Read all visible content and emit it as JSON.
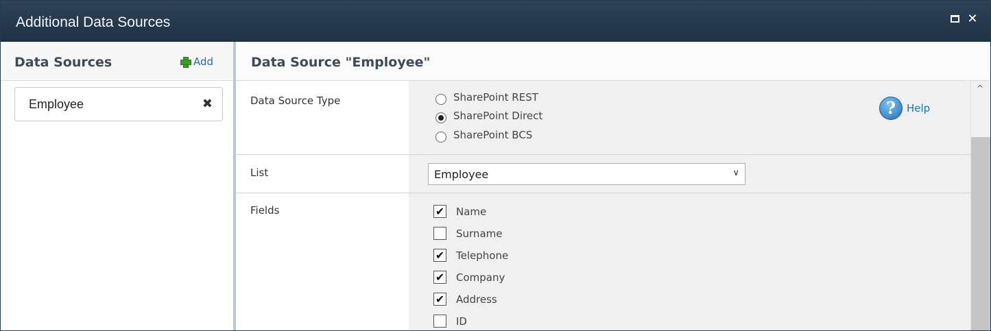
{
  "window": {
    "title": "Additional Data Sources"
  },
  "left": {
    "header": "Data Sources",
    "add_label": "Add",
    "items": [
      {
        "label": "Employee"
      }
    ]
  },
  "right": {
    "header": "Data Source \"Employee\"",
    "type_label": "Data Source Type",
    "type_options": [
      {
        "label": "SharePoint REST",
        "selected": false
      },
      {
        "label": "SharePoint Direct",
        "selected": true
      },
      {
        "label": "SharePoint BCS",
        "selected": false
      }
    ],
    "help_label": "Help",
    "list_label": "List",
    "list_value": "Employee",
    "fields_label": "Fields",
    "fields": [
      {
        "label": "Name",
        "checked": true
      },
      {
        "label": "Surname",
        "checked": false
      },
      {
        "label": "Telephone",
        "checked": true
      },
      {
        "label": "Company",
        "checked": true
      },
      {
        "label": "Address",
        "checked": true
      },
      {
        "label": "ID",
        "checked": false
      }
    ]
  },
  "icons": {
    "maximize": "maximize-icon",
    "close": "close-icon",
    "add": "plus-icon",
    "remove": "remove-icon",
    "help": "help-icon",
    "dropdown": "chevron-down-icon",
    "scroll_up": "chevron-up-icon"
  },
  "colors": {
    "titlebar": "#203246",
    "link": "#1f6fb2",
    "divider": "#b7c8d9",
    "add_icon": "#3f9a2a"
  }
}
